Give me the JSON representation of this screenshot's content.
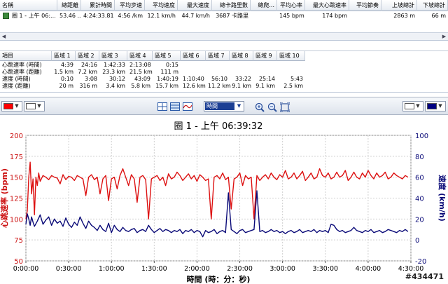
{
  "activity_table": {
    "headers": [
      "名稱",
      "總距離",
      "累計時間",
      "平均步速",
      "平均速度",
      "最大速度",
      "總卡路里數",
      "總爬...",
      "平均心率",
      "最大心跳速率",
      "平均節奏",
      "上坡總計",
      "下坡總計"
    ],
    "row": {
      "name": "圈 1 - 上午 06:...",
      "distance": "53.46 ...",
      "total_time": "4:24:33.81",
      "avg_pace": "4:56 /km",
      "avg_speed": "12.1 km/h",
      "max_speed": "44.7 km/h",
      "calories": "3687 卡路里",
      "climb": "",
      "avg_hr": "145 bpm",
      "max_hr": "174 bpm",
      "avg_cadence": "",
      "ascent": "2863 m",
      "descent": "66 m"
    }
  },
  "zone_table": {
    "headers": [
      "項目",
      "區域 1",
      "區域 2",
      "區域 3",
      "區域 4",
      "區域 5",
      "區域 6",
      "區域 7",
      "區域 8",
      "區域 9",
      "區域 10"
    ],
    "rows": [
      {
        "label": "心跳速率 (時間)",
        "values": [
          "4:39",
          "24:16",
          "1:42:33",
          "2:13:08",
          "0:15",
          "",
          "",
          "",
          "",
          ""
        ]
      },
      {
        "label": "心跳速率 (距離)",
        "values": [
          "1.5 km",
          "7.2 km",
          "23.3 km",
          "21.5 km",
          "111 m",
          "",
          "",
          "",
          "",
          ""
        ]
      },
      {
        "label": "速度 (時間)",
        "values": [
          "0:10",
          "3:08",
          "30:12",
          "43:09",
          "1:40:19",
          "1:10:40",
          "56:10",
          "33:22",
          "25:14",
          "5:43"
        ]
      },
      {
        "label": "速度 (距離)",
        "values": [
          "20 m",
          "316 m",
          "3.4 km",
          "5.8 km",
          "15.7 km",
          "12.6 km",
          "11.2 km",
          "9.1 km",
          "9.1 km",
          "2.5 km"
        ]
      }
    ]
  },
  "toolbar": {
    "left_color": "#ff0000",
    "left_color2": "#ffffff",
    "right_color": "#000080",
    "right_color2": "#ffffff",
    "xaxis_mode": "時間",
    "icons": [
      "grid-icon",
      "fit-icon",
      "smooth-icon",
      "zoom-in-icon",
      "zoom-out-icon",
      "zoom-fit-icon"
    ]
  },
  "chart_data": {
    "type": "line",
    "title": "圈 1 - 上午 06:39:32",
    "xlabel": "時間 (時：分：秒)",
    "ylabel_left": "心跳速率 (bpm)",
    "ylabel_right": "速度 (km/h)",
    "x_ticks": [
      "0:00:00",
      "0:30:00",
      "1:00:00",
      "1:30:00",
      "2:00:00",
      "2:30:00",
      "3:00:00",
      "3:30:00",
      "4:00:00",
      "4:30:00"
    ],
    "x_range_min": [
      0,
      270
    ],
    "ylim_left": [
      50,
      200
    ],
    "yticks_left": [
      50,
      75,
      100,
      125,
      150,
      175,
      200
    ],
    "ylim_right": [
      -20,
      100
    ],
    "yticks_right": [
      -20,
      0,
      20,
      40,
      60,
      80,
      100
    ],
    "grid": true,
    "series": [
      {
        "name": "心跳速率",
        "axis": "left",
        "color": "#dd1111",
        "x": [
          0,
          1,
          2,
          3,
          4,
          5,
          6,
          7,
          8,
          9,
          10,
          12,
          14,
          16,
          18,
          20,
          22,
          24,
          26,
          28,
          30,
          32,
          34,
          36,
          38,
          40,
          42,
          44,
          46,
          48,
          50,
          52,
          54,
          56,
          58,
          60,
          62,
          64,
          66,
          68,
          70,
          72,
          74,
          76,
          78,
          80,
          82,
          84,
          86,
          88,
          90,
          92,
          94,
          96,
          98,
          100,
          102,
          104,
          106,
          108,
          110,
          112,
          114,
          116,
          118,
          120,
          122,
          124,
          126,
          128,
          130,
          132,
          134,
          136,
          138,
          140,
          142,
          144,
          146,
          148,
          150,
          152,
          154,
          156,
          158,
          160,
          162,
          164,
          166,
          168,
          170,
          172,
          174,
          176,
          178,
          180,
          182,
          184,
          186,
          188,
          190,
          192,
          194,
          196,
          198,
          200,
          202,
          204,
          206,
          208,
          210,
          212,
          214,
          216,
          218,
          220,
          222,
          224,
          226,
          228,
          230,
          232,
          234,
          236,
          238,
          240,
          242,
          244,
          246,
          248,
          250,
          252,
          254,
          256,
          258,
          260,
          262,
          264,
          266,
          268
        ],
        "y": [
          100,
          110,
          150,
          168,
          130,
          148,
          105,
          150,
          140,
          155,
          145,
          152,
          150,
          147,
          152,
          150,
          149,
          142,
          153,
          147,
          151,
          150,
          146,
          152,
          150,
          148,
          128,
          150,
          153,
          147,
          150,
          130,
          148,
          152,
          122,
          148,
          150,
          136,
          152,
          160,
          150,
          140,
          153,
          148,
          120,
          150,
          152,
          147,
          100,
          148,
          150,
          152,
          146,
          150,
          140,
          154,
          148,
          150,
          156,
          152,
          146,
          150,
          154,
          148,
          152,
          145,
          153,
          150,
          146,
          148,
          100,
          150,
          152,
          148,
          155,
          147,
          150,
          112,
          148,
          150,
          155,
          140,
          152,
          148,
          150,
          100,
          152,
          146,
          150,
          153,
          148,
          155,
          150,
          147,
          153,
          150,
          158,
          148,
          150,
          155,
          148,
          152,
          157,
          146,
          150,
          155,
          148,
          150,
          160,
          152,
          150,
          155,
          148,
          150,
          156,
          150,
          152,
          158,
          146,
          150,
          156,
          150,
          148,
          155,
          150,
          158,
          152,
          148,
          155,
          150,
          152,
          156,
          148,
          150,
          155,
          152,
          150,
          148,
          152,
          150
        ]
      },
      {
        "name": "速度",
        "axis": "right",
        "color": "#0a0a78",
        "x": [
          0,
          1,
          2,
          3,
          4,
          5,
          6,
          8,
          10,
          12,
          14,
          16,
          18,
          20,
          22,
          24,
          26,
          28,
          30,
          32,
          34,
          36,
          38,
          40,
          42,
          44,
          46,
          48,
          50,
          52,
          54,
          56,
          58,
          60,
          62,
          64,
          66,
          68,
          70,
          72,
          74,
          76,
          78,
          80,
          82,
          84,
          86,
          88,
          90,
          92,
          94,
          96,
          98,
          100,
          102,
          104,
          106,
          108,
          110,
          112,
          114,
          116,
          118,
          120,
          122,
          124,
          126,
          128,
          130,
          132,
          134,
          136,
          138,
          140,
          142,
          144,
          146,
          148,
          150,
          152,
          154,
          156,
          158,
          160,
          162,
          164,
          166,
          168,
          170,
          172,
          174,
          176,
          178,
          180,
          182,
          184,
          186,
          188,
          190,
          192,
          194,
          196,
          198,
          200,
          202,
          204,
          206,
          208,
          210,
          212,
          214,
          216,
          218,
          220,
          222,
          224,
          226,
          228,
          230,
          232,
          234,
          236,
          238,
          240,
          242,
          244,
          246,
          248,
          250,
          252,
          254,
          256,
          258,
          260,
          262,
          264,
          266,
          268
        ],
        "y": [
          15,
          25,
          20,
          14,
          22,
          17,
          13,
          18,
          24,
          15,
          19,
          22,
          14,
          20,
          16,
          18,
          13,
          21,
          15,
          12,
          17,
          14,
          22,
          16,
          11,
          18,
          14,
          12,
          9,
          14,
          10,
          8,
          16,
          7,
          14,
          10,
          8,
          12,
          9,
          8,
          10,
          11,
          7,
          9,
          10,
          8,
          14,
          10,
          7,
          9,
          11,
          8,
          10,
          9,
          7,
          9,
          8,
          10,
          6,
          9,
          8,
          10,
          7,
          9,
          8,
          3,
          9,
          7,
          8,
          10,
          6,
          8,
          9,
          7,
          45,
          10,
          8,
          6,
          9,
          10,
          7,
          8,
          9,
          10,
          47,
          8,
          9,
          7,
          8,
          10,
          8,
          9,
          7,
          8,
          6,
          8,
          9,
          7,
          8,
          10,
          7,
          8,
          9,
          8,
          10,
          7,
          9,
          8,
          9,
          7,
          15,
          14,
          10,
          8,
          9,
          7,
          8,
          9,
          12,
          9,
          8,
          7,
          9,
          8,
          10,
          7,
          8,
          9,
          7,
          8,
          10,
          9,
          8,
          7,
          9,
          8,
          10,
          8
        ]
      }
    ]
  },
  "watermark": "#434471"
}
